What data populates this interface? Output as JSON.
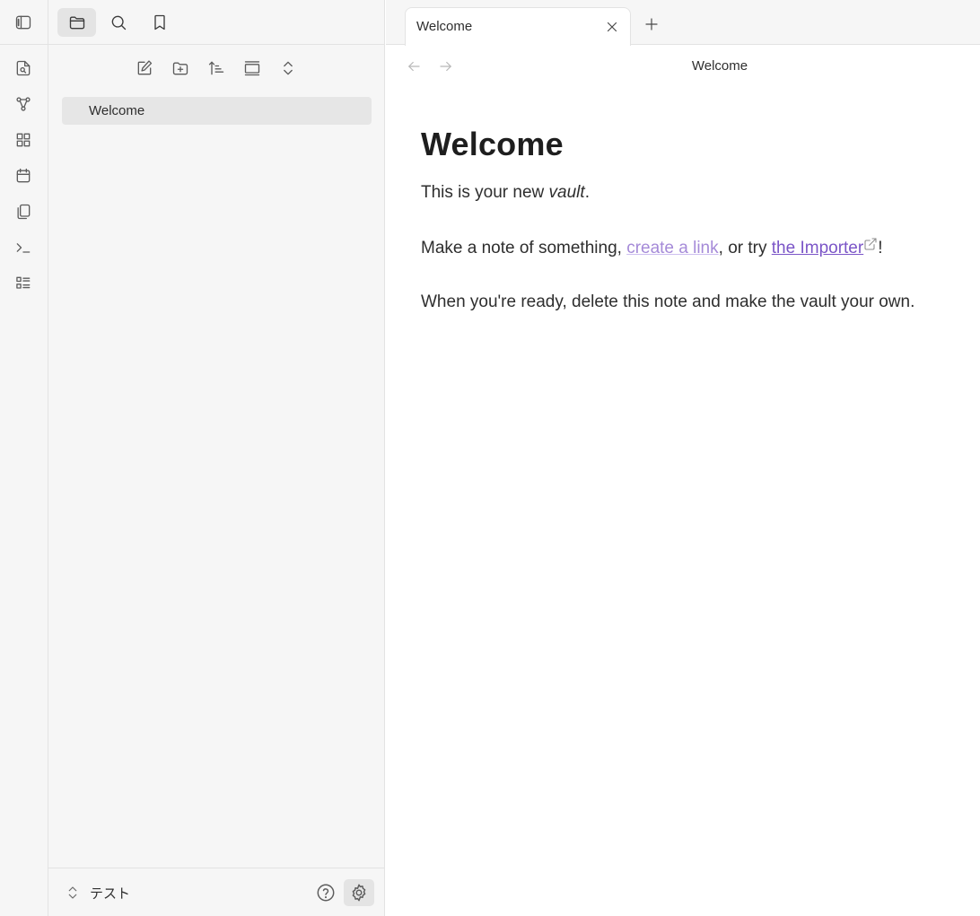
{
  "sidebar": {
    "tabs": [
      "files",
      "search",
      "bookmarks"
    ],
    "files": [
      {
        "label": "Welcome"
      }
    ],
    "vault": {
      "name": "テスト"
    }
  },
  "tabs": [
    {
      "label": "Welcome"
    }
  ],
  "view": {
    "title": "Welcome"
  },
  "note": {
    "title": "Welcome",
    "para1_prefix": "This is your new ",
    "para1_em": "vault",
    "para1_suffix": ".",
    "para2_prefix": "Make a note of something, ",
    "link_internal": "create a link",
    "para2_mid": ", or try ",
    "link_external": "the Importer",
    "para2_suffix": "!",
    "para3": "When you're ready, delete this note and make the vault your own."
  },
  "colors": {
    "internal_link": "#a58ad8",
    "external_link": "#7b55c7",
    "sidebar_bg": "#f6f6f6",
    "active_item_bg": "#e6e6e6"
  }
}
